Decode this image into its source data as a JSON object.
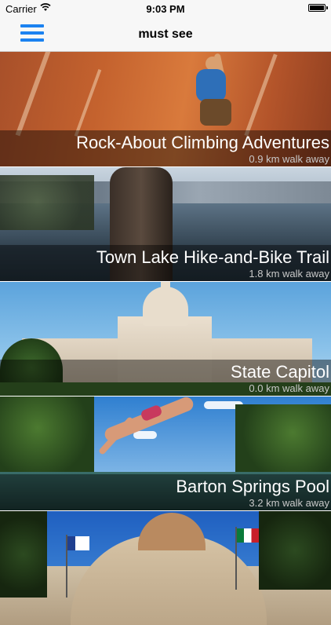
{
  "status_bar": {
    "carrier": "Carrier",
    "time": "9:03 PM"
  },
  "nav": {
    "title": "must see",
    "menu_icon": "hamburger-menu-icon"
  },
  "places": [
    {
      "name": "Rock-About Climbing Adventures",
      "distance": "0.9 km walk away"
    },
    {
      "name": "Town Lake Hike-and-Bike Trail",
      "distance": "1.8 km walk away"
    },
    {
      "name": "State Capitol",
      "distance": "0.0 km walk away"
    },
    {
      "name": "Barton Springs Pool",
      "distance": "3.2 km walk away"
    },
    {
      "name": "",
      "distance": ""
    }
  ],
  "colors": {
    "accent": "#1b82f0",
    "nav_background": "#f7f7f7",
    "caption_overlay": "rgba(0,0,0,0.42)"
  }
}
